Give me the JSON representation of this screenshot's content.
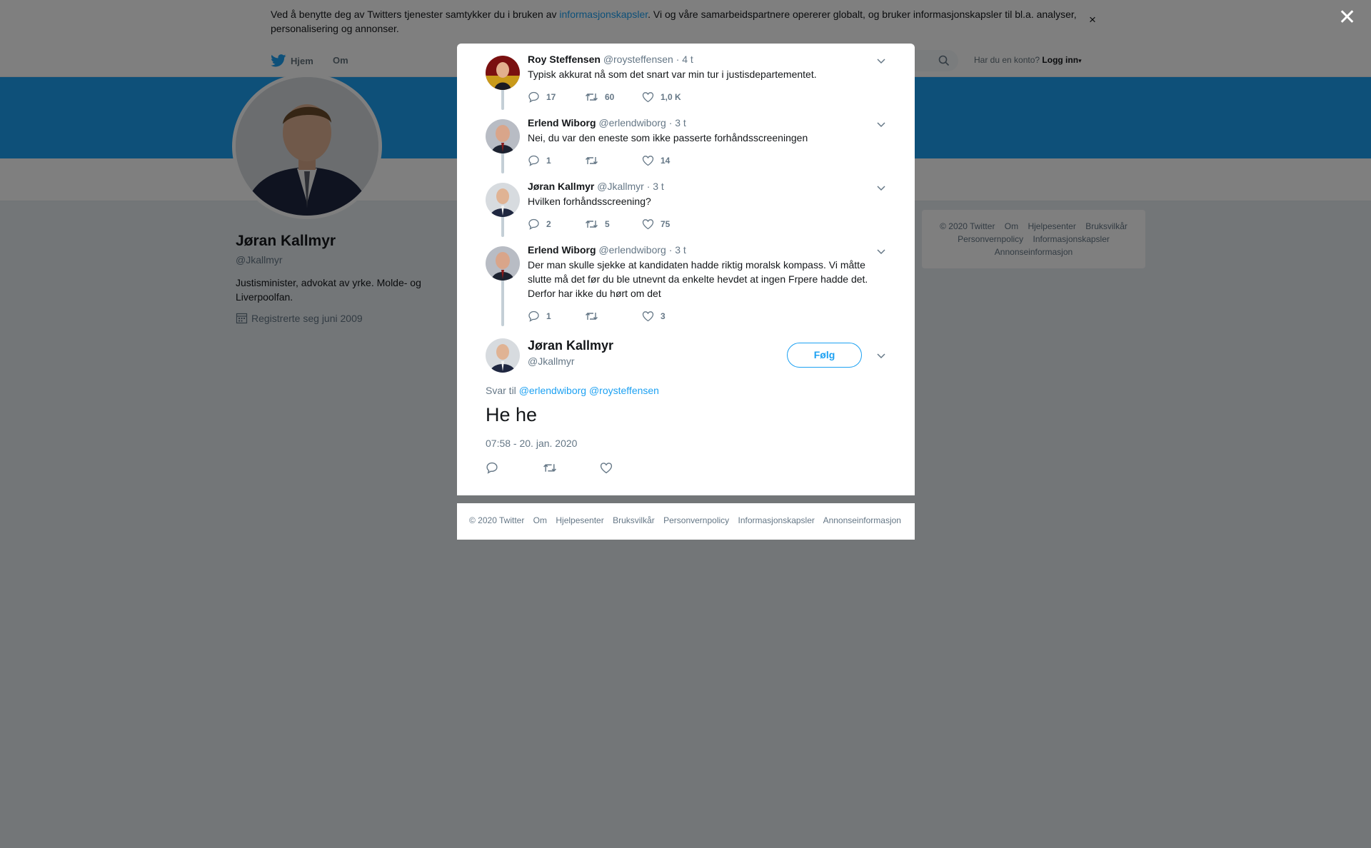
{
  "cookie": {
    "text_before": "Ved å benytte deg av Twitters tjenester samtykker du i bruken av ",
    "link": "informasjonskapsler",
    "text_after": ". Vi og våre samarbeidspartnere opererer globalt, og bruker informasjonskapsler til bl.a. analyser, personalisering og annonser.",
    "close": "×"
  },
  "nav": {
    "home": "Hjem",
    "about": "Om",
    "login_prompt": "Har du en konto?",
    "login": "Logg inn"
  },
  "profile": {
    "name": "Jøran Kallmyr",
    "handle": "@Jkallmyr",
    "bio": "Justisminister, advokat av yrke. Molde- og Liverpoolfan.",
    "joined": "Registrerte seg juni 2009"
  },
  "side_footer": {
    "links": [
      "© 2020 Twitter",
      "Om",
      "Hjelpesenter",
      "Bruksvilkår",
      "Personvernpolicy",
      "Informasjonskapsler",
      "Annonseinformasjon"
    ]
  },
  "modal": {
    "close": "✕",
    "tweets": [
      {
        "name": "Roy Steffensen",
        "meta": "@roysteffensen · 4 t",
        "text": "Typisk akkurat nå som det snart var min tur i justisdepartementet.",
        "replies": "17",
        "retweets": "60",
        "likes": "1,0 K"
      },
      {
        "name": "Erlend Wiborg",
        "meta": "@erlendwiborg · 3 t",
        "text": "Nei, du var den eneste som ikke passerte forhåndsscreeningen",
        "replies": "1",
        "retweets": "",
        "likes": "14"
      },
      {
        "name": "Jøran Kallmyr",
        "meta": "@Jkallmyr · 3 t",
        "text": "Hvilken forhåndsscreening?",
        "replies": "2",
        "retweets": "5",
        "likes": "75"
      },
      {
        "name": "Erlend Wiborg",
        "meta": "@erlendwiborg · 3 t",
        "text": "Der man skulle sjekke at kandidaten hadde riktig moralsk kompass. Vi måtte slutte må det før du ble utnevnt da enkelte hevdet at ingen Frpere hadde det. Derfor har ikke du hørt om det",
        "replies": "1",
        "retweets": "",
        "likes": "3"
      }
    ],
    "main": {
      "name": "Jøran Kallmyr",
      "handle": "@Jkallmyr",
      "follow": "Følg",
      "reply_label": "Svar til",
      "reply_to_1": "@erlendwiborg",
      "reply_to_2": "@roysteffensen",
      "text": "He he",
      "time": "07:58 - 20. jan. 2020"
    },
    "footer": {
      "links": [
        "© 2020 Twitter",
        "Om",
        "Hjelpesenter",
        "Bruksvilkår",
        "Personvernpolicy",
        "Informasjonskapsler",
        "Annonseinformasjon"
      ]
    }
  },
  "colors": {
    "accent": "#1da1f2",
    "banner": "#1da1f2",
    "overlay": "rgba(0,0,0,0.5)"
  },
  "icons": [
    "twitter-bird-icon",
    "search-icon",
    "calendar-icon",
    "reply-icon",
    "retweet-icon",
    "like-icon",
    "chevron-down-icon",
    "close-icon"
  ]
}
